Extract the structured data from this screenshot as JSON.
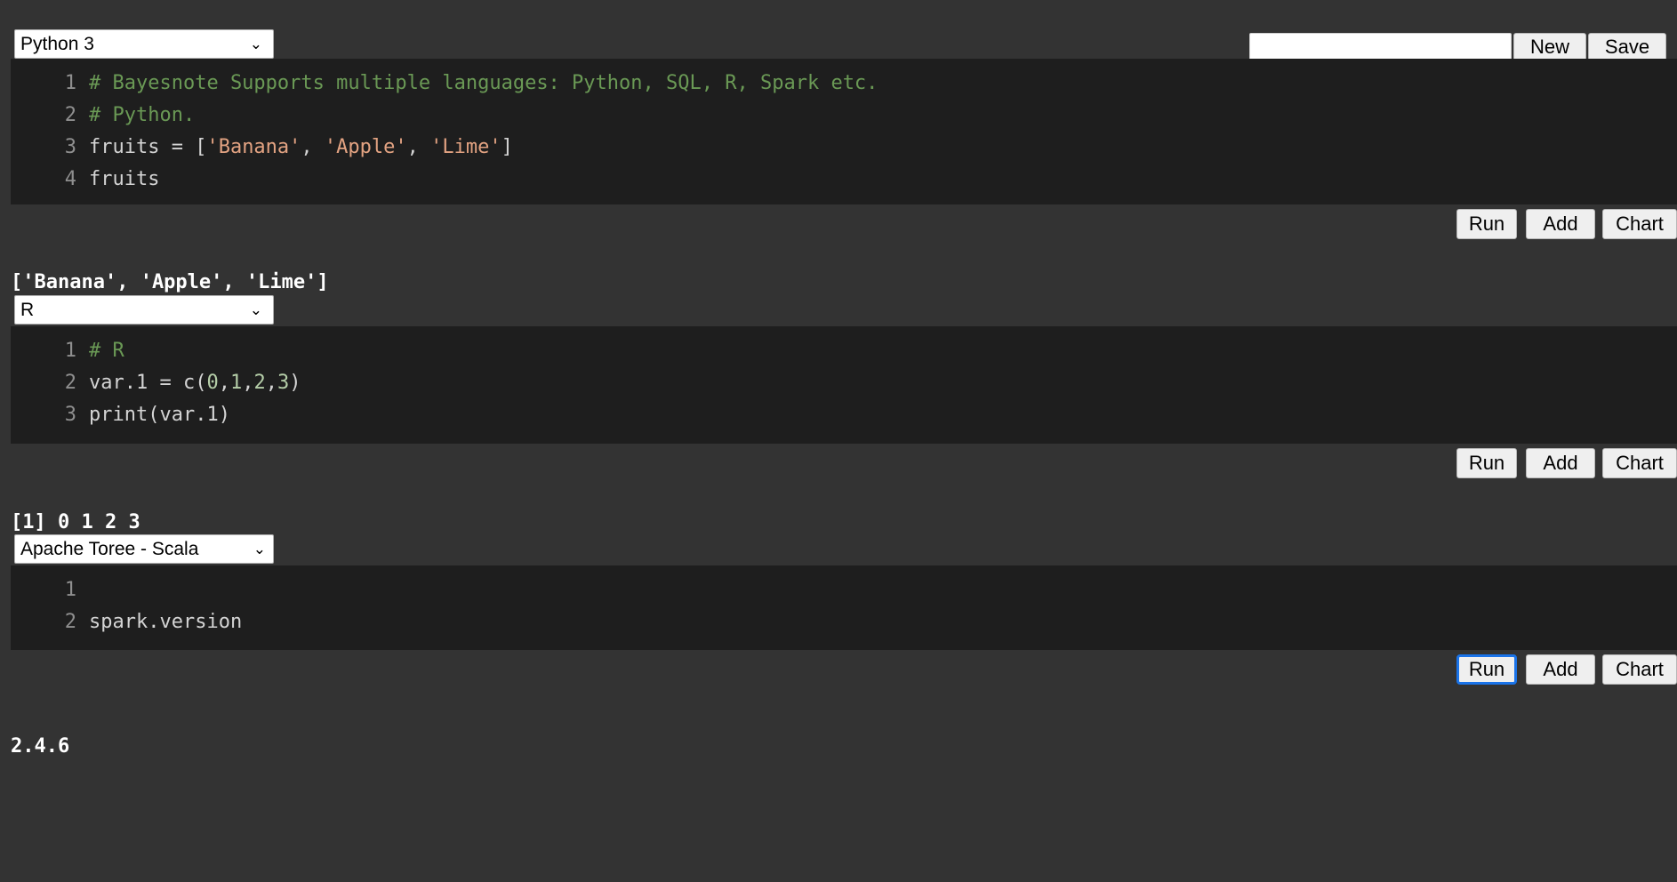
{
  "app": {
    "name": "Bayesnote Notebook",
    "background": "#333333",
    "editor_background": "#1e1e1e",
    "accent_focus": "#1a73e8"
  },
  "toolbar": {
    "notebook_name_value": "",
    "notebook_name_placeholder": "",
    "new_label": "New",
    "save_label": "Save"
  },
  "cell_buttons": {
    "run_label": "Run",
    "add_label": "Add",
    "chart_label": "Chart"
  },
  "icons": {
    "chevron_down": "⌄"
  },
  "cells": [
    {
      "kernel": "Python 3",
      "lines": [
        {
          "n": "1",
          "segments": [
            {
              "text": "# Bayesnote Supports multiple languages: Python, SQL, R, Spark etc.",
              "type": "comment"
            }
          ]
        },
        {
          "n": "2",
          "segments": [
            {
              "text": "# Python.",
              "type": "comment"
            }
          ]
        },
        {
          "n": "3",
          "segments": [
            {
              "text": "fruits = [",
              "type": "plain"
            },
            {
              "text": "'Banana'",
              "type": "string"
            },
            {
              "text": ", ",
              "type": "plain"
            },
            {
              "text": "'Apple'",
              "type": "string"
            },
            {
              "text": ", ",
              "type": "plain"
            },
            {
              "text": "'Lime'",
              "type": "string"
            },
            {
              "text": "]",
              "type": "plain"
            }
          ]
        },
        {
          "n": "4",
          "segments": [
            {
              "text": "fruits",
              "type": "plain"
            }
          ]
        }
      ],
      "output": "['Banana', 'Apple', 'Lime']",
      "run_focused": false
    },
    {
      "kernel": "R",
      "lines": [
        {
          "n": "1",
          "segments": [
            {
              "text": "# R",
              "type": "comment"
            }
          ]
        },
        {
          "n": "2",
          "segments": [
            {
              "text": "var.1 = c(",
              "type": "plain"
            },
            {
              "text": "0",
              "type": "num"
            },
            {
              "text": ",",
              "type": "plain"
            },
            {
              "text": "1",
              "type": "num"
            },
            {
              "text": ",",
              "type": "plain"
            },
            {
              "text": "2",
              "type": "num"
            },
            {
              "text": ",",
              "type": "plain"
            },
            {
              "text": "3",
              "type": "num"
            },
            {
              "text": ")",
              "type": "plain"
            }
          ]
        },
        {
          "n": "3",
          "segments": [
            {
              "text": "print(var.1)",
              "type": "plain"
            }
          ]
        }
      ],
      "output": "[1] 0 1 2 3",
      "run_focused": false
    },
    {
      "kernel": "Apache Toree - Scala",
      "lines": [
        {
          "n": "1",
          "segments": [
            {
              "text": "",
              "type": "plain"
            }
          ]
        },
        {
          "n": "2",
          "segments": [
            {
              "text": "spark.version",
              "type": "plain"
            }
          ]
        }
      ],
      "output": "2.4.6",
      "run_focused": true
    }
  ]
}
